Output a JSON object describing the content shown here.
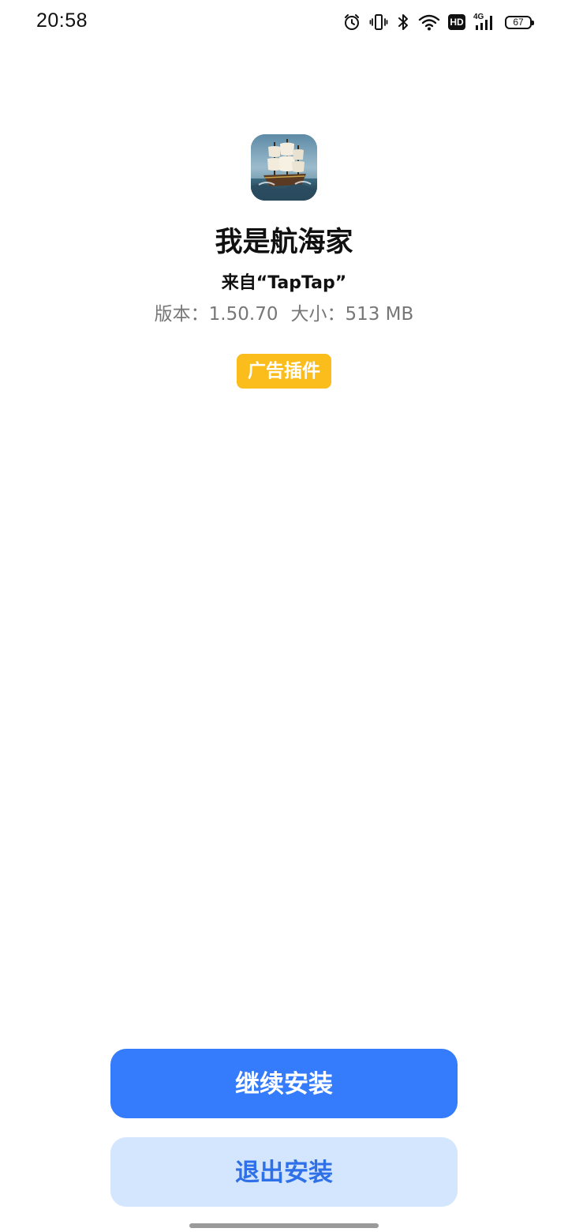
{
  "status_bar": {
    "time": "20:58",
    "icons": [
      "alarm-icon",
      "vibrate-icon",
      "bluetooth-icon",
      "wifi-icon",
      "hd-icon",
      "4g-signal-icon",
      "battery-icon"
    ],
    "hd_label": "HD",
    "network_label": "4G",
    "battery_level": "67"
  },
  "app": {
    "icon": "sailing-ship-app-icon",
    "name": "我是航海家",
    "source": "来自“TapTap”",
    "version_text": "版本：1.50.70",
    "size_text": "大小：513 MB",
    "badge": "广告插件"
  },
  "actions": {
    "continue_label": "继续安装",
    "exit_label": "退出安装"
  },
  "colors": {
    "primary": "#357cfd",
    "secondary_bg": "#d3e6fd",
    "secondary_text": "#2e70e8",
    "badge": "#fbbd1b"
  }
}
